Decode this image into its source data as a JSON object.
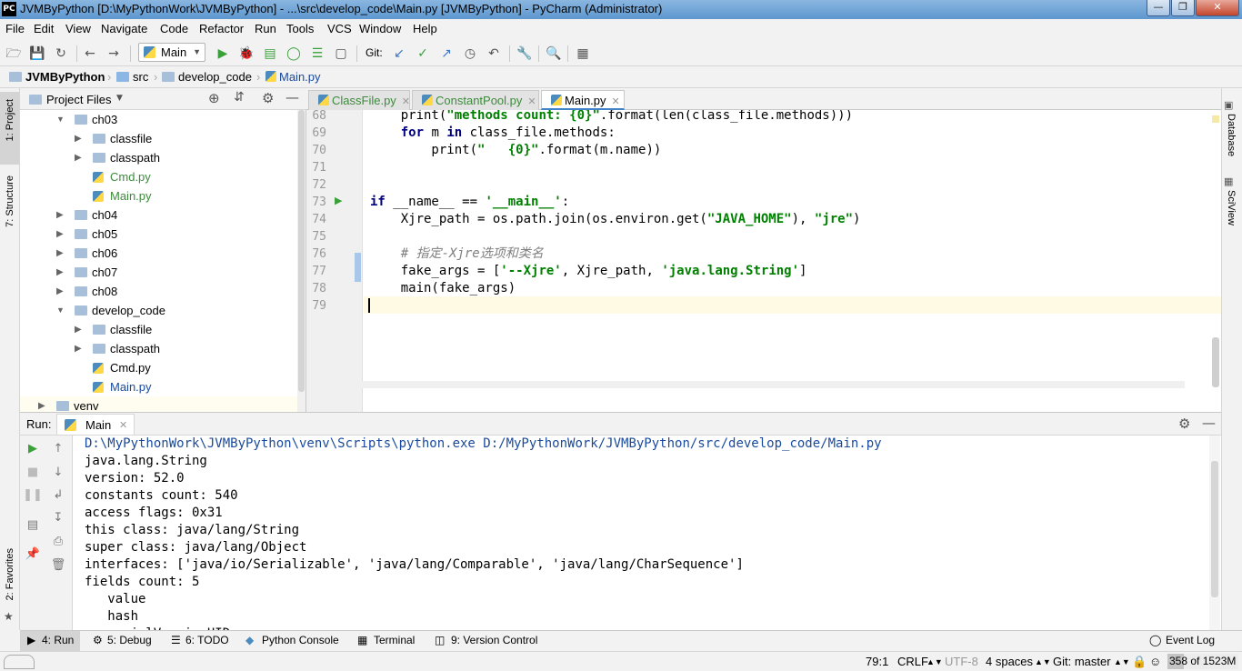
{
  "window": {
    "app_badge": "PC",
    "title": "JVMByPython [D:\\MyPythonWork\\JVMByPython] - ...\\src\\develop_code\\Main.py [JVMByPython] - PyCharm (Administrator)"
  },
  "menu": [
    "File",
    "Edit",
    "View",
    "Navigate",
    "Code",
    "Refactor",
    "Run",
    "Tools",
    "VCS",
    "Window",
    "Help"
  ],
  "toolbar": {
    "run_config": "Main",
    "git_label": "Git:"
  },
  "breadcrumb": [
    "JVMByPython",
    "src",
    "develop_code",
    "Main.py"
  ],
  "left_strip": {
    "project": "1: Project",
    "structure": "7: Structure",
    "favorites": "2: Favorites"
  },
  "right_strip": {
    "database": "Database",
    "sciview": "SciView"
  },
  "project_panel": {
    "title": "Project Files",
    "tree": [
      {
        "label": "ch03",
        "type": "folder",
        "expanded": true,
        "indent": 1
      },
      {
        "label": "classfile",
        "type": "folder",
        "expanded": false,
        "indent": 2
      },
      {
        "label": "classpath",
        "type": "folder",
        "expanded": false,
        "indent": 2
      },
      {
        "label": "Cmd.py",
        "type": "py-modified",
        "indent": 2
      },
      {
        "label": "Main.py",
        "type": "py-modified",
        "indent": 2
      },
      {
        "label": "ch04",
        "type": "folder",
        "expanded": false,
        "indent": 1
      },
      {
        "label": "ch05",
        "type": "folder",
        "expanded": false,
        "indent": 1
      },
      {
        "label": "ch06",
        "type": "folder",
        "expanded": false,
        "indent": 1
      },
      {
        "label": "ch07",
        "type": "folder",
        "expanded": false,
        "indent": 1
      },
      {
        "label": "ch08",
        "type": "folder",
        "expanded": false,
        "indent": 1
      },
      {
        "label": "develop_code",
        "type": "folder",
        "expanded": true,
        "indent": 1
      },
      {
        "label": "classfile",
        "type": "folder",
        "expanded": false,
        "indent": 2
      },
      {
        "label": "classpath",
        "type": "folder",
        "expanded": false,
        "indent": 2
      },
      {
        "label": "Cmd.py",
        "type": "py",
        "indent": 2
      },
      {
        "label": "Main.py",
        "type": "py-blue",
        "indent": 2
      },
      {
        "label": "venv",
        "type": "folder",
        "expanded": false,
        "indent": 0
      }
    ]
  },
  "editor": {
    "tabs": [
      {
        "label": "ClassFile.py",
        "active": false
      },
      {
        "label": "ConstantPool.py",
        "active": false
      },
      {
        "label": "Main.py",
        "active": true
      }
    ],
    "lines": [
      {
        "n": "68",
        "html": "    print(<span class=\"str\">\"methods count: {0}\"</span>.format(len(class_file.methods)))"
      },
      {
        "n": "69",
        "html": "    <span class=\"kw\">for</span> m <span class=\"kw\">in</span> class_file.methods:"
      },
      {
        "n": "70",
        "html": "        print(<span class=\"str\">\"   {0}\"</span>.format(m.name))"
      },
      {
        "n": "71",
        "html": ""
      },
      {
        "n": "72",
        "html": ""
      },
      {
        "n": "73",
        "html": "<span class=\"kw\">if</span> __name__ == <span class=\"str\">'__main__'</span>:"
      },
      {
        "n": "74",
        "html": "    Xjre_path = os.path.join(os.environ.get(<span class=\"str\">\"JAVA_HOME\"</span>), <span class=\"str\">\"jre\"</span>)"
      },
      {
        "n": "75",
        "html": ""
      },
      {
        "n": "76",
        "html": "    <span class=\"cmt\"># 指定-Xjre选项和类名</span>"
      },
      {
        "n": "77",
        "html": "    fake_args = [<span class=\"str\">'--Xjre'</span>, Xjre_path, <span class=\"str\">'java.lang.String'</span>]"
      },
      {
        "n": "78",
        "html": "    main(fake_args)"
      },
      {
        "n": "79",
        "html": ""
      }
    ]
  },
  "run_panel": {
    "label": "Run:",
    "tab": "Main",
    "output": [
      "D:\\MyPythonWork\\JVMByPython\\venv\\Scripts\\python.exe D:/MyPythonWork/JVMByPython/src/develop_code/Main.py",
      "java.lang.String",
      "version: 52.0",
      "constants count: 540",
      "access flags: 0x31",
      "this class: java/lang/String",
      "super class: java/lang/Object",
      "interfaces: ['java/io/Serializable', 'java/lang/Comparable', 'java/lang/CharSequence']",
      "fields count: 5",
      "   value",
      "   hash",
      "   serialVersionUID"
    ]
  },
  "bottom_tabs": [
    "4: Run",
    "5: Debug",
    "6: TODO",
    "Python Console",
    "Terminal",
    "9: Version Control"
  ],
  "event_log": "Event Log",
  "status": {
    "position": "79:1",
    "line_sep": "CRLF",
    "encoding": "UTF-8",
    "indent": "4 spaces",
    "git": "Git: master",
    "memory": "358 of 1523M"
  },
  "colors": {
    "accent": "#4083c9",
    "keyword": "#000080",
    "string": "#008000",
    "caret_line": "#fffae3"
  }
}
